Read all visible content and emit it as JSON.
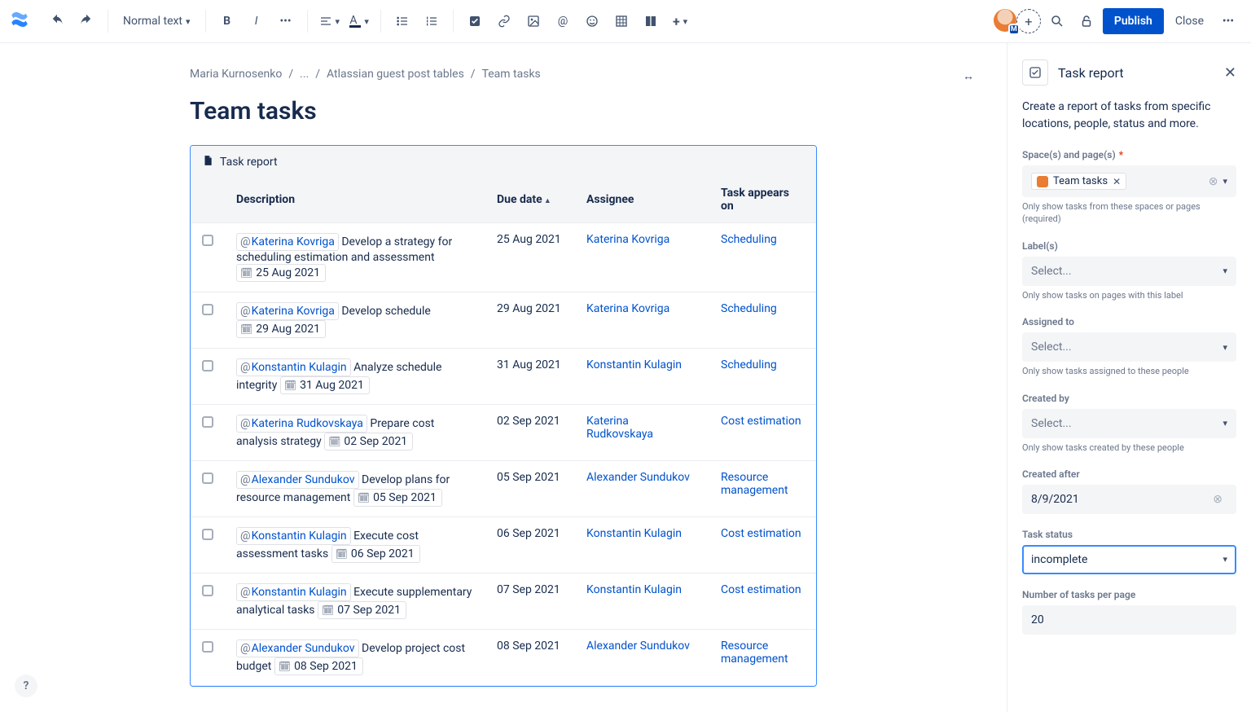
{
  "toolbar": {
    "text_style": "Normal text",
    "publish_label": "Publish",
    "close_label": "Close",
    "avatar_initial": "M"
  },
  "breadcrumbs": {
    "items": [
      "Maria Kurnosenko",
      "...",
      "Atlassian guest post tables",
      "Team tasks"
    ]
  },
  "page_title": "Team tasks",
  "macro_title": "Task report",
  "columns": {
    "description": "Description",
    "due_date": "Due date",
    "assignee": "Assignee",
    "appears_on": "Task appears on"
  },
  "tasks": [
    {
      "mention": "Katerina Kovriga",
      "text": "Develop a strategy for scheduling estimation and assessment",
      "date": "25 Aug 2021",
      "due": "25 Aug 2021",
      "assignee": "Katerina Kovriga",
      "appears": "Scheduling"
    },
    {
      "mention": "Katerina Kovriga",
      "text": "Develop schedule",
      "date": "29 Aug 2021",
      "due": "29 Aug 2021",
      "assignee": "Katerina Kovriga",
      "appears": "Scheduling"
    },
    {
      "mention": "Konstantin Kulagin",
      "text": "Analyze schedule integrity",
      "date": "31 Aug 2021",
      "due": "31 Aug 2021",
      "assignee": "Konstantin Kulagin",
      "appears": "Scheduling"
    },
    {
      "mention": "Katerina Rudkovskaya",
      "text": "Prepare cost analysis strategy",
      "date": "02 Sep 2021",
      "due": "02 Sep 2021",
      "assignee": "Katerina Rudkovskaya",
      "appears": "Cost estimation"
    },
    {
      "mention": "Alexander Sundukov",
      "text": "Develop plans for resource management",
      "date": "05 Sep 2021",
      "due": "05 Sep 2021",
      "assignee": "Alexander Sundukov",
      "appears": "Resource management"
    },
    {
      "mention": "Konstantin Kulagin",
      "text": "Execute cost assessment tasks",
      "date": "06 Sep 2021",
      "due": "06 Sep 2021",
      "assignee": "Konstantin Kulagin",
      "appears": "Cost estimation"
    },
    {
      "mention": "Konstantin Kulagin",
      "text": "Execute supplementary analytical tasks",
      "date": "07 Sep 2021",
      "due": "07 Sep 2021",
      "assignee": "Konstantin Kulagin",
      "appears": "Cost estimation"
    },
    {
      "mention": "Alexander Sundukov",
      "text": "Develop project cost budget",
      "date": "08 Sep 2021",
      "due": "08 Sep 2021",
      "assignee": "Alexander Sundukov",
      "appears": "Resource management"
    }
  ],
  "panel": {
    "title": "Task report",
    "description": "Create a report of tasks from specific locations, people, status and more.",
    "spaces_label": "Space(s) and page(s)",
    "spaces_chip": "Team tasks",
    "spaces_hint": "Only show tasks from these spaces or pages (required)",
    "labels_label": "Label(s)",
    "labels_placeholder": "Select...",
    "labels_hint": "Only show tasks on pages with this label",
    "assigned_label": "Assigned to",
    "assigned_placeholder": "Select...",
    "assigned_hint": "Only show tasks assigned to these people",
    "created_by_label": "Created by",
    "created_by_placeholder": "Select...",
    "created_by_hint": "Only show tasks created by these people",
    "created_after_label": "Created after",
    "created_after_value": "8/9/2021",
    "status_label": "Task status",
    "status_value": "incomplete",
    "per_page_label": "Number of tasks per page",
    "per_page_value": "20"
  }
}
